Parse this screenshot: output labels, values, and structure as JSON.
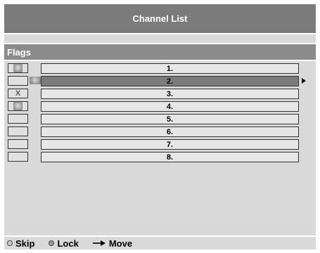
{
  "header": {
    "title": "Channel List"
  },
  "section": {
    "title": "Flags"
  },
  "channels": [
    {
      "label": "1.",
      "flag": "skip",
      "selected": false
    },
    {
      "label": "2.",
      "flag": "",
      "selected": true,
      "icon": "skip"
    },
    {
      "label": "3.",
      "flag": "X",
      "selected": false
    },
    {
      "label": "4.",
      "flag": "lock",
      "selected": false
    },
    {
      "label": "5.",
      "flag": "",
      "selected": false
    },
    {
      "label": "6.",
      "flag": "",
      "selected": false
    },
    {
      "label": "7.",
      "flag": "",
      "selected": false
    },
    {
      "label": "8.",
      "flag": "",
      "selected": false
    }
  ],
  "footer": {
    "skip_label": "Skip",
    "lock_label": "Lock",
    "move_label": "Move"
  },
  "colors": {
    "panel": "#d9d9d9",
    "header": "#7b7b7b",
    "selected": "#7c7c7c"
  }
}
